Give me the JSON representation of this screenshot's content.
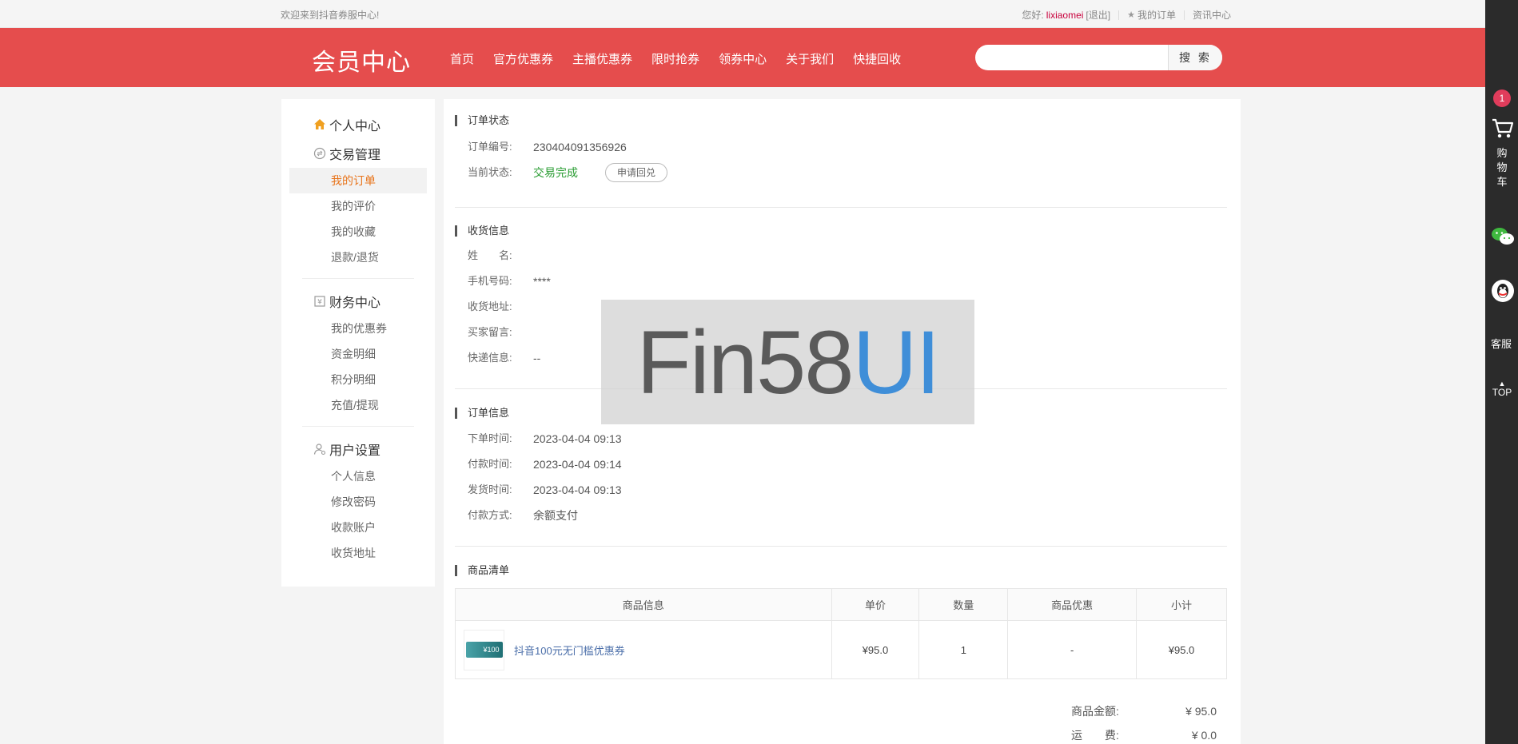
{
  "topbar": {
    "welcome": "欢迎来到抖音券服中心!",
    "greeting": "您好:",
    "username": "lixiaomei",
    "logout": "[退出]",
    "my_orders": "我的订单",
    "news": "资讯中心"
  },
  "header": {
    "brand": "会员中心",
    "nav": [
      "首页",
      "官方优惠券",
      "主播优惠券",
      "限时抢券",
      "领券中心",
      "关于我们",
      "快捷回收"
    ],
    "search_placeholder": "",
    "search_button": "搜 索"
  },
  "sidebar": {
    "personal": "个人中心",
    "trade": {
      "title": "交易管理",
      "items": [
        "我的订单",
        "我的评价",
        "我的收藏",
        "退款/退货"
      ]
    },
    "finance": {
      "title": "财务中心",
      "items": [
        "我的优惠券",
        "资金明细",
        "积分明细",
        "充值/提现"
      ]
    },
    "user": {
      "title": "用户设置",
      "items": [
        "个人信息",
        "修改密码",
        "收款账户",
        "收货地址"
      ]
    }
  },
  "order_status": {
    "title": "订单状态",
    "order_no_label": "订单编号:",
    "order_no": "230404091356926",
    "status_label": "当前状态:",
    "status": "交易完成",
    "apply_button": "申请回兑"
  },
  "shipping": {
    "title": "收货信息",
    "name_label": "姓　　名:",
    "name": "",
    "phone_label": "手机号码:",
    "phone": "****",
    "address_label": "收货地址:",
    "address": "",
    "message_label": "买家留言:",
    "message": "",
    "express_label": "快递信息:",
    "express": "--"
  },
  "order_info": {
    "title": "订单信息",
    "order_time_label": "下单时间:",
    "order_time": "2023-04-04 09:13",
    "pay_time_label": "付款时间:",
    "pay_time": "2023-04-04 09:14",
    "ship_time_label": "发货时间:",
    "ship_time": "2023-04-04 09:13",
    "pay_method_label": "付款方式:",
    "pay_method": "余额支付"
  },
  "goods": {
    "title": "商品清单",
    "headers": [
      "商品信息",
      "单价",
      "数量",
      "商品优惠",
      "小计"
    ],
    "rows": [
      {
        "name": "抖音100元无门槛优惠券",
        "thumb_text": "¥100",
        "price": "¥95.0",
        "qty": "1",
        "discount": "-",
        "subtotal": "¥95.0"
      }
    ]
  },
  "totals": {
    "goods_amount_label": "商品金额:",
    "goods_amount": "¥ 95.0",
    "shipping_label": "运　　费:",
    "shipping": "¥ 0.0"
  },
  "watermark": {
    "part1": "Fin58",
    "part2": "UI"
  },
  "rightbar": {
    "cart_count": "1",
    "cart_label": "购物车",
    "service": "客服",
    "top": "TOP"
  }
}
